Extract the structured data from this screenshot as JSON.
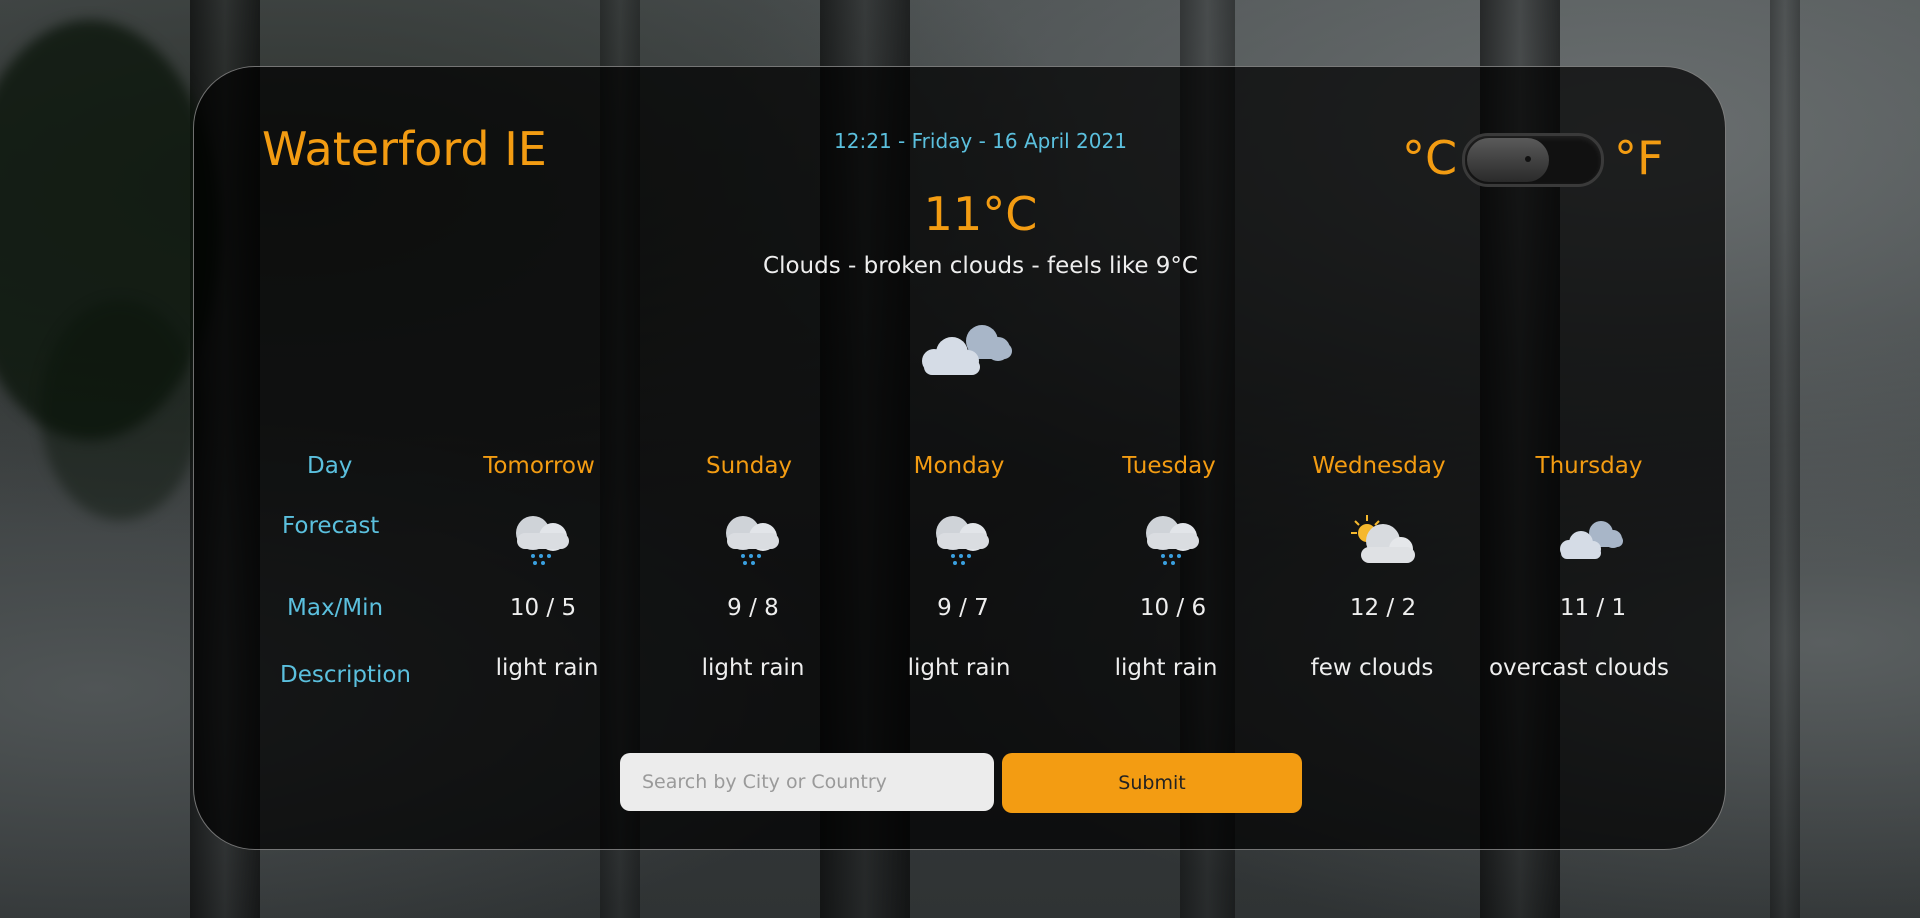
{
  "location": "Waterford IE",
  "datetime": "12:21 - Friday - 16 April 2021",
  "units": {
    "celsius": "°C",
    "fahrenheit": "°F"
  },
  "current": {
    "temperature": "11°C",
    "description": "Clouds - broken clouds - feels like 9°C",
    "icon": "broken-clouds-icon"
  },
  "row_labels": {
    "day": "Day",
    "forecast": "Forecast",
    "maxmin": "Max/Min",
    "description": "Description"
  },
  "forecast": [
    {
      "day": "Tomorrow",
      "icon": "light-rain-icon",
      "maxmin": "10 / 5",
      "description": "light rain"
    },
    {
      "day": "Sunday",
      "icon": "light-rain-icon",
      "maxmin": "9 / 8",
      "description": "light rain"
    },
    {
      "day": "Monday",
      "icon": "light-rain-icon",
      "maxmin": "9 / 7",
      "description": "light rain"
    },
    {
      "day": "Tuesday",
      "icon": "light-rain-icon",
      "maxmin": "10 / 6",
      "description": "light rain"
    },
    {
      "day": "Wednesday",
      "icon": "few-clouds-icon",
      "maxmin": "12 / 2",
      "description": "few clouds"
    },
    {
      "day": "Thursday",
      "icon": "overcast-clouds-icon",
      "maxmin": "11 / 1",
      "description": "overcast clouds"
    }
  ],
  "search": {
    "placeholder": "Search by City or Country",
    "value": ""
  },
  "submit_label": "Submit",
  "colors": {
    "accent": "#f39c12",
    "label": "#5bc0de",
    "text": "#eeeeee"
  }
}
